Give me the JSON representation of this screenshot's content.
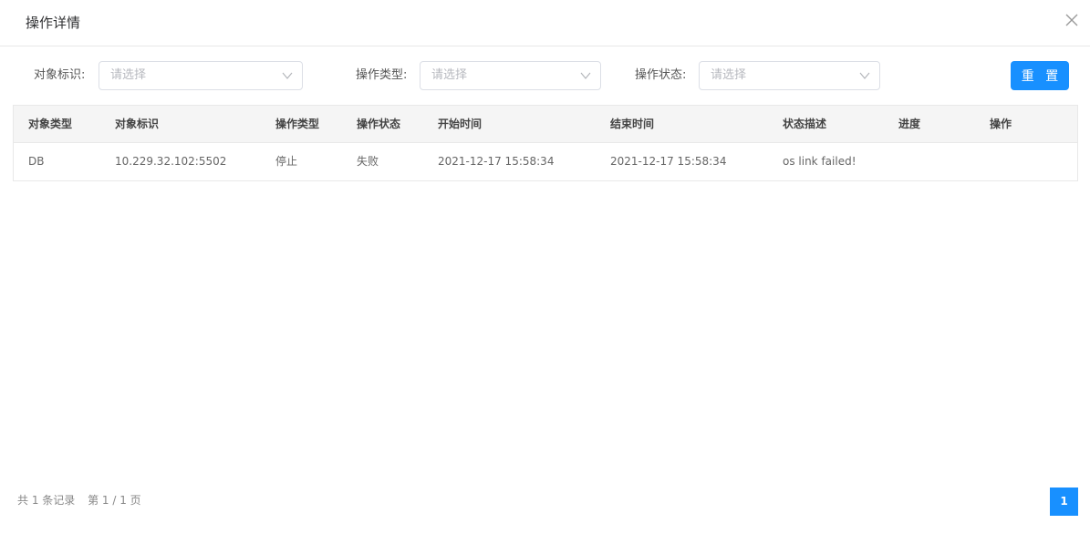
{
  "dialog": {
    "title": "操作详情"
  },
  "filters": {
    "object_id": {
      "label": "对象标识:",
      "placeholder": "请选择"
    },
    "op_type": {
      "label": "操作类型:",
      "placeholder": "请选择"
    },
    "op_status": {
      "label": "操作状态:",
      "placeholder": "请选择"
    },
    "reset_label": "重 置"
  },
  "table": {
    "columns": [
      "对象类型",
      "对象标识",
      "操作类型",
      "操作状态",
      "开始时间",
      "结束时间",
      "状态描述",
      "进度",
      "操作"
    ],
    "rows": [
      [
        "DB",
        "10.229.32.102:5502",
        "停止",
        "失败",
        "2021-12-17 15:58:34",
        "2021-12-17 15:58:34",
        "os link failed!",
        "",
        ""
      ]
    ]
  },
  "pagination": {
    "total_text": "共 1 条记录",
    "page_text": "第 1 / 1 页",
    "current_page": "1"
  },
  "colors": {
    "accent": "#1890ff",
    "header_bg": "#f5f5f5",
    "border": "#e8e8e8"
  },
  "icons": {
    "close": "close-icon",
    "dropdown": "chevron-down-icon"
  }
}
